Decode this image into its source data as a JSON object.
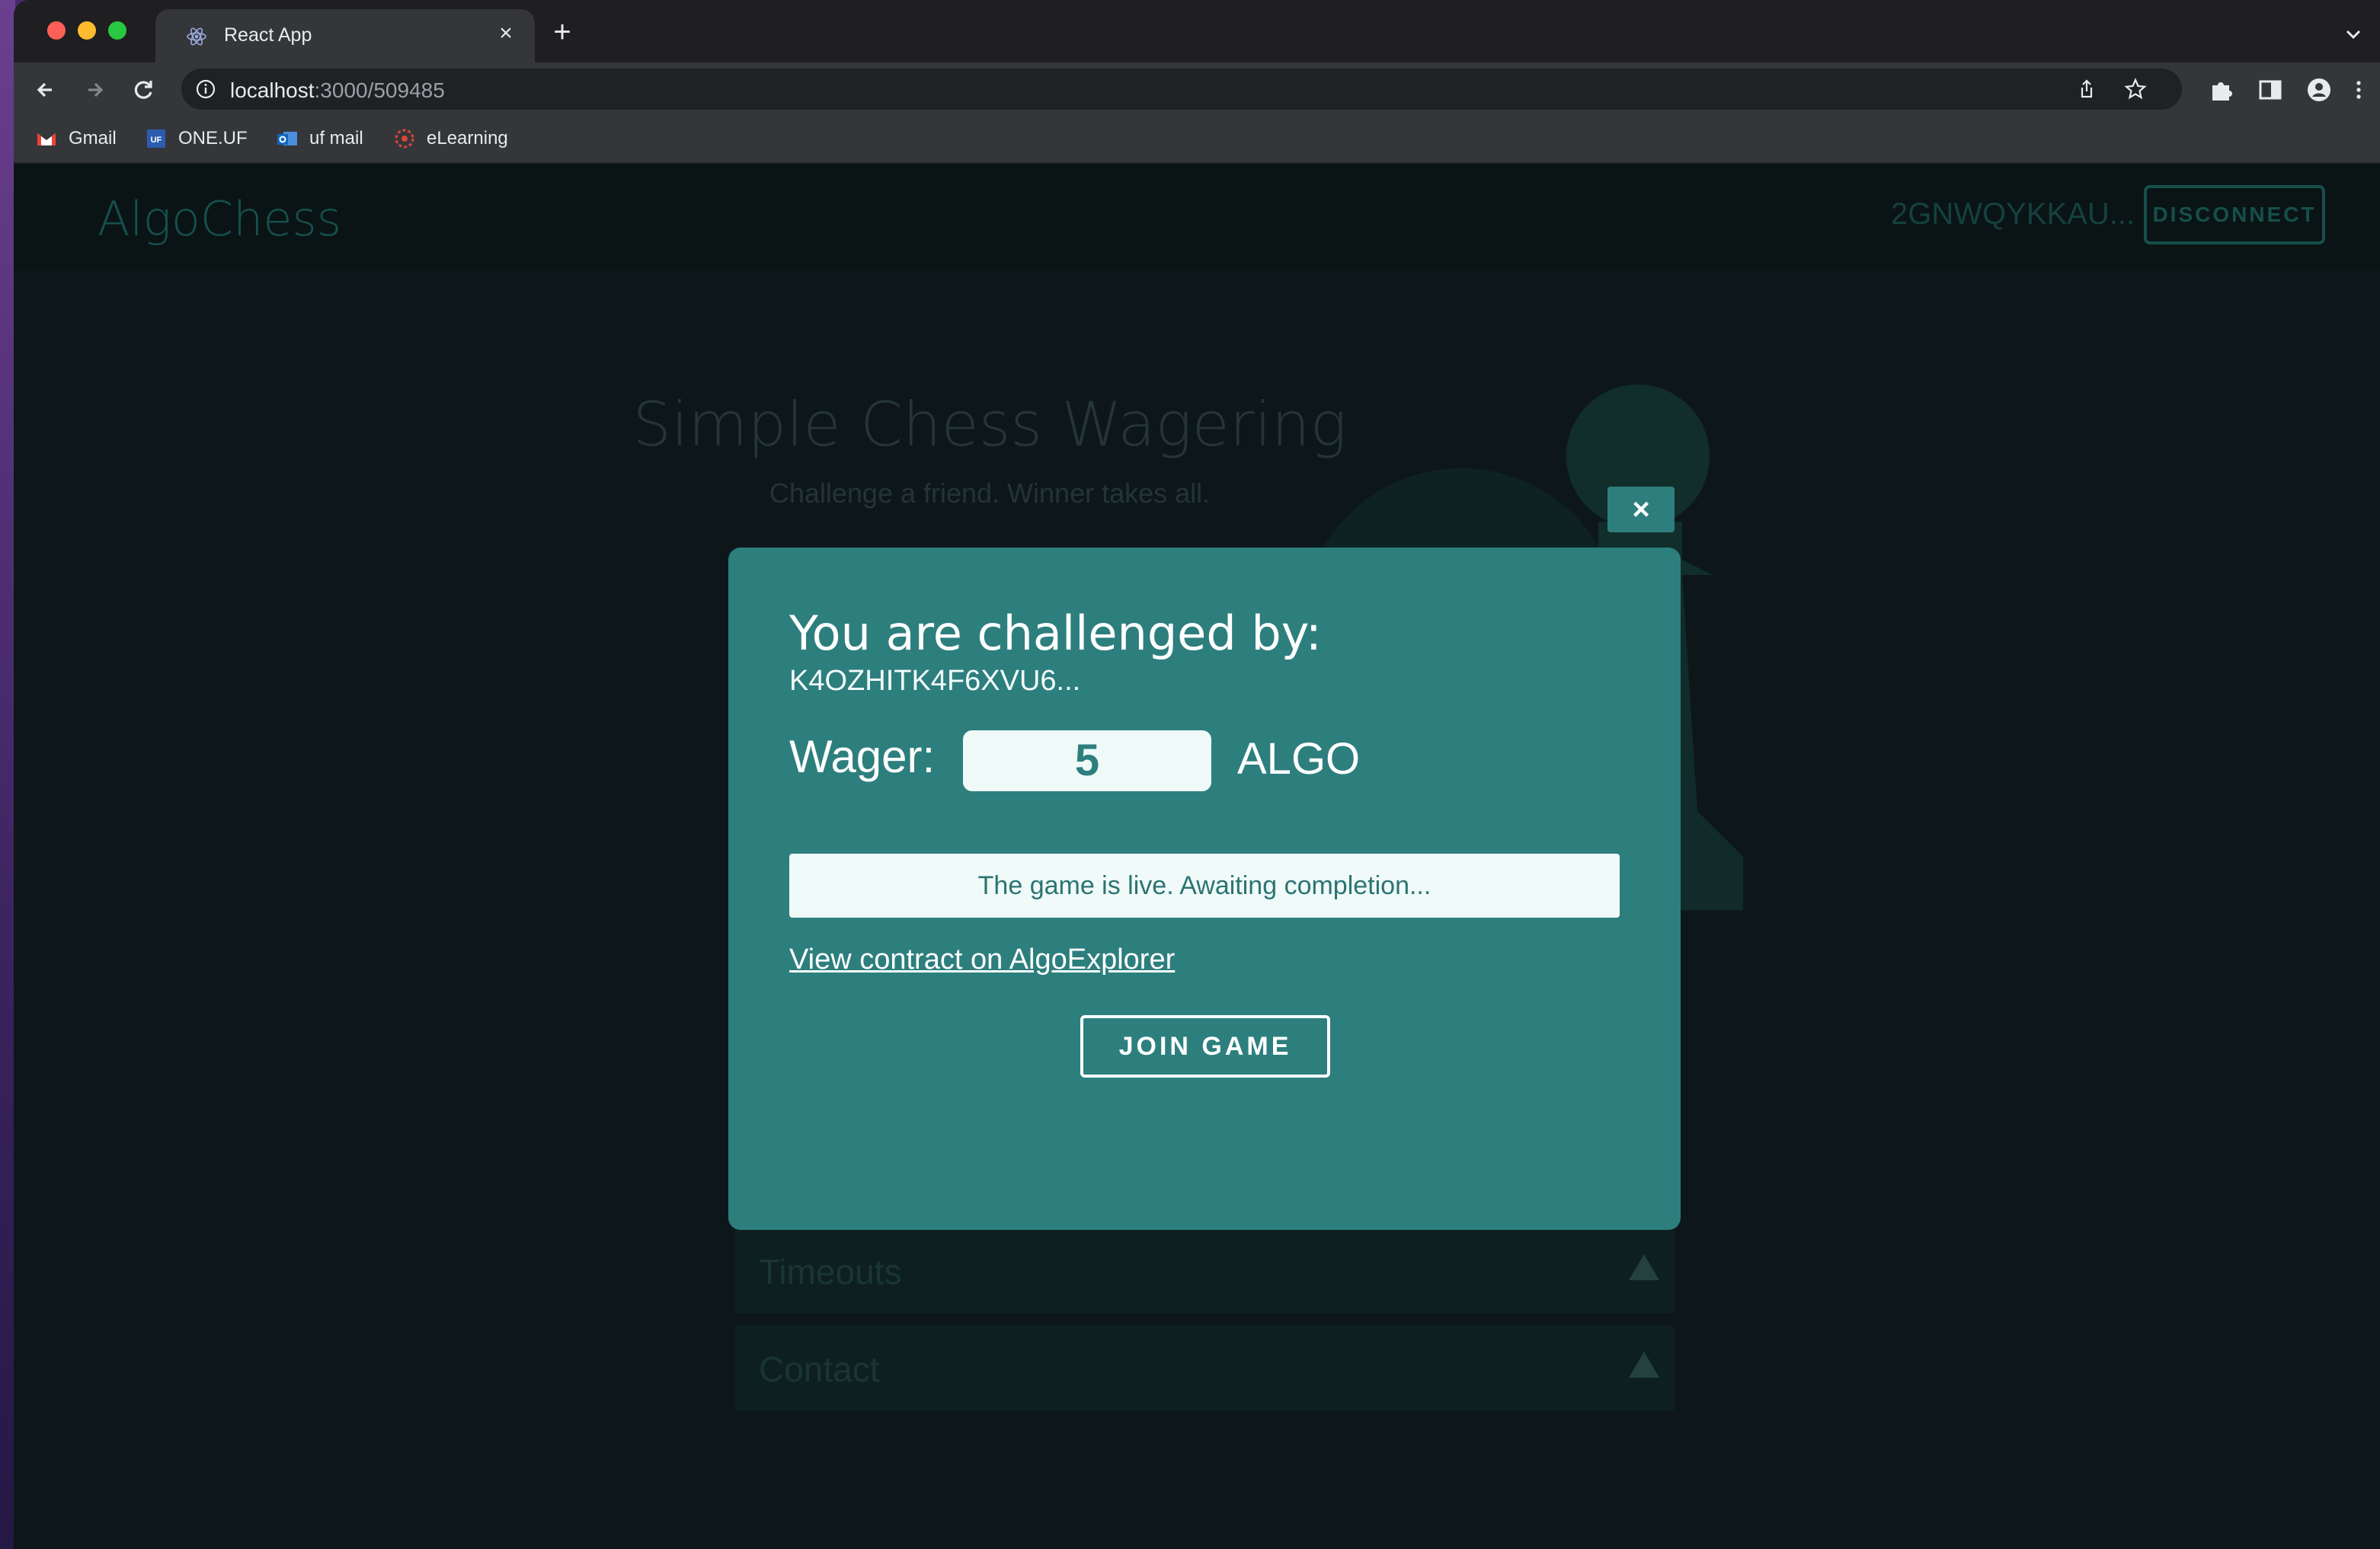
{
  "browser": {
    "tab_title": "React App",
    "url_host": "localhost",
    "url_path": ":3000/509485",
    "bookmarks": [
      {
        "label": "Gmail",
        "icon": "gmail-icon"
      },
      {
        "label": "ONE.UF",
        "icon": "one-uf-icon"
      },
      {
        "label": "uf mail",
        "icon": "outlook-icon"
      },
      {
        "label": "eLearning",
        "icon": "elearning-icon"
      }
    ]
  },
  "app": {
    "logo": "AlgoChess",
    "account": "2GNWQYKKAU...",
    "disconnect_label": "DISCONNECT",
    "hero_title": "Simple Chess Wagering",
    "hero_subtitle": "Challenge a friend. Winner takes all.",
    "accordions": [
      {
        "label": "Timeouts"
      },
      {
        "label": "Contact"
      }
    ]
  },
  "modal": {
    "close_label": "×",
    "heading": "You are challenged by:",
    "challenger": "K4OZHITK4F6XVU6...",
    "wager_label": "Wager:",
    "wager_value": "5",
    "currency": "ALGO",
    "status": "The game is live. Awaiting completion...",
    "explorer_link": "View contract on AlgoExplorer",
    "join_label": "JOIN GAME"
  },
  "colors": {
    "modal_bg": "#2d7f7e",
    "page_bg": "#0f1b1e",
    "accent_dim": "#1a5c58"
  }
}
